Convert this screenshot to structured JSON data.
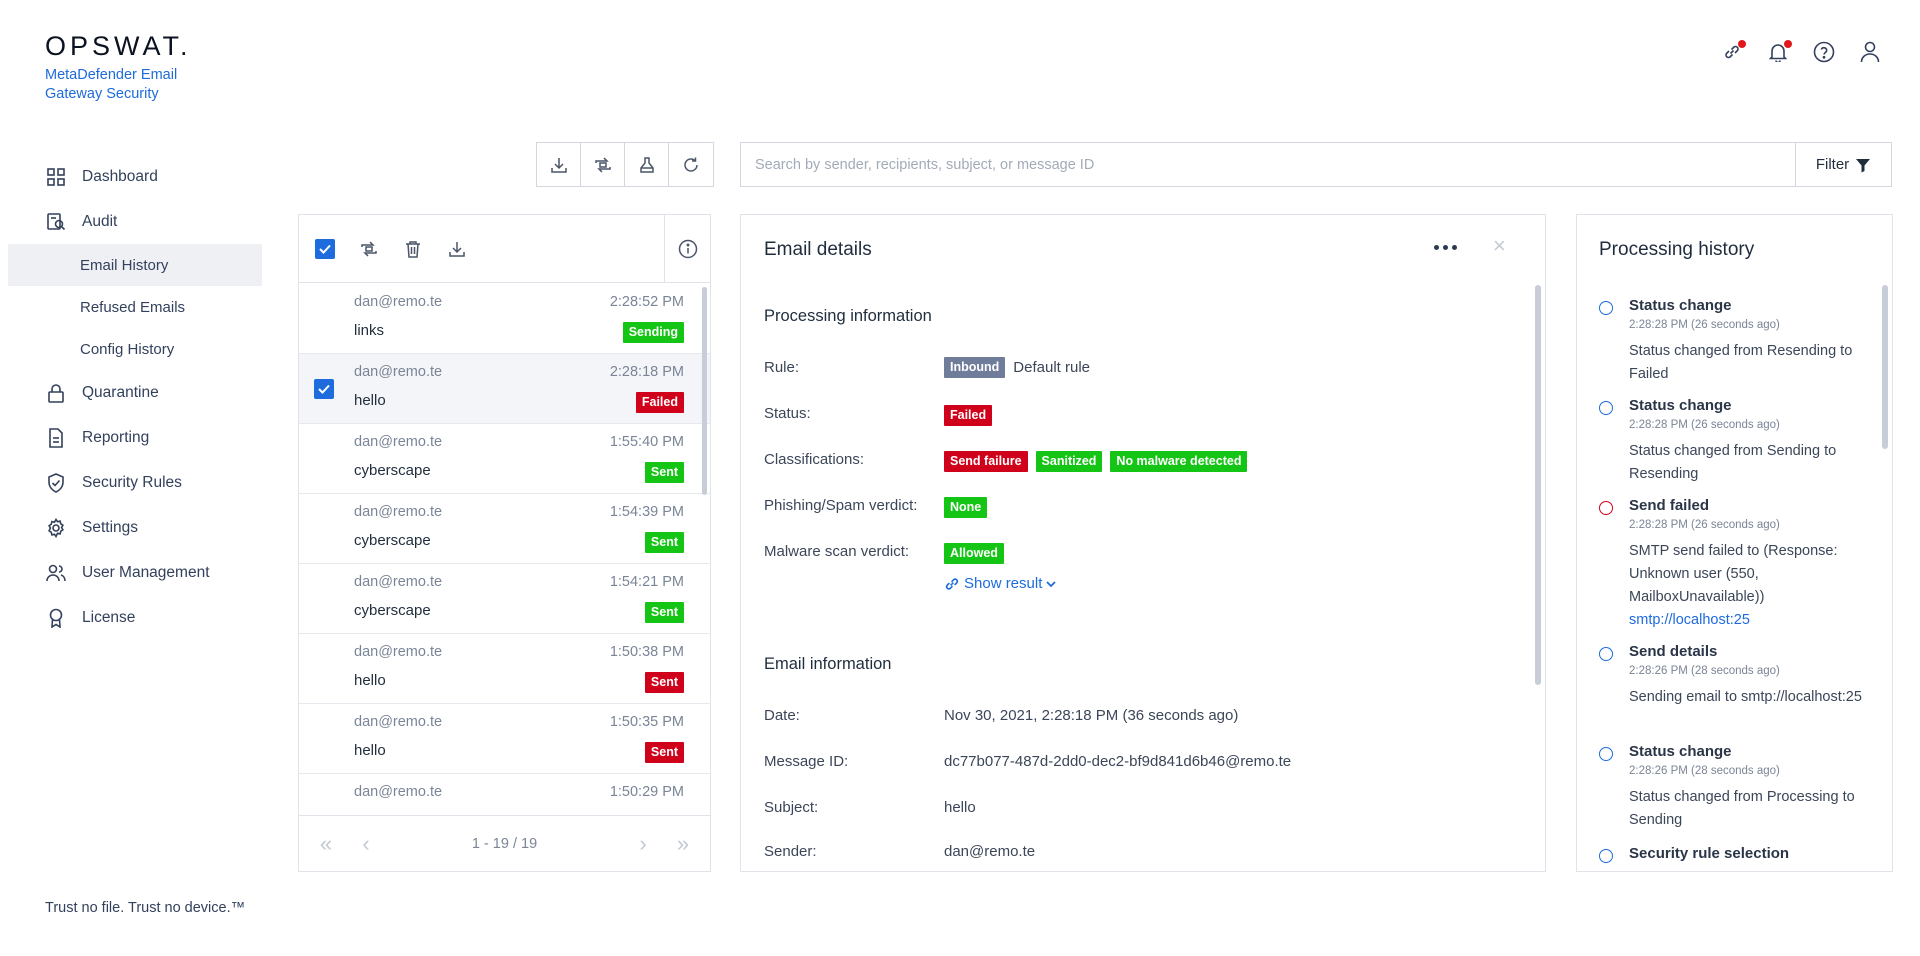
{
  "brand": {
    "logo": "OPSWAT.",
    "product": "MetaDefender Email Gateway Security"
  },
  "nav": {
    "dashboard": "Dashboard",
    "audit": "Audit",
    "email_history": "Email History",
    "refused_emails": "Refused Emails",
    "config_history": "Config History",
    "quarantine": "Quarantine",
    "reporting": "Reporting",
    "security_rules": "Security Rules",
    "settings": "Settings",
    "user_management": "User Management",
    "license": "License"
  },
  "footer": "Trust no file. Trust no device.™",
  "search": {
    "placeholder": "Search by sender, recipients, subject, or message ID",
    "filter_label": "Filter"
  },
  "list": {
    "rows": [
      {
        "from": "dan@remo.te",
        "time": "2:28:52 PM",
        "subject": "links",
        "status": "Sending",
        "status_color": "green",
        "selected": false
      },
      {
        "from": "dan@remo.te",
        "time": "2:28:18 PM",
        "subject": "hello",
        "status": "Failed",
        "status_color": "red",
        "selected": true
      },
      {
        "from": "dan@remo.te",
        "time": "1:55:40 PM",
        "subject": "cyberscape",
        "status": "Sent",
        "status_color": "green",
        "selected": false
      },
      {
        "from": "dan@remo.te",
        "time": "1:54:39 PM",
        "subject": "cyberscape",
        "status": "Sent",
        "status_color": "green",
        "selected": false
      },
      {
        "from": "dan@remo.te",
        "time": "1:54:21 PM",
        "subject": "cyberscape",
        "status": "Sent",
        "status_color": "green",
        "selected": false
      },
      {
        "from": "dan@remo.te",
        "time": "1:50:38 PM",
        "subject": "hello",
        "status": "Sent",
        "status_color": "red",
        "selected": false
      },
      {
        "from": "dan@remo.te",
        "time": "1:50:35 PM",
        "subject": "hello",
        "status": "Sent",
        "status_color": "red",
        "selected": false
      },
      {
        "from": "dan@remo.te",
        "time": "1:50:29 PM",
        "subject": "",
        "status": "",
        "status_color": "red",
        "selected": false
      }
    ],
    "pagination": "1 - 19 / 19"
  },
  "details": {
    "title": "Email details",
    "processing": {
      "title": "Processing information",
      "rule_label": "Rule:",
      "rule_badge": "Inbound",
      "rule_value": "Default rule",
      "status_label": "Status:",
      "status_badge": "Failed",
      "classifications_label": "Classifications:",
      "classifications": [
        "Send failure",
        "Sanitized",
        "No malware detected"
      ],
      "phishing_label": "Phishing/Spam verdict:",
      "phishing_badge": "None",
      "malware_label": "Malware scan verdict:",
      "malware_badge": "Allowed",
      "show_result": "Show result"
    },
    "email": {
      "title": "Email information",
      "date_label": "Date:",
      "date_value": "Nov 30, 2021, 2:28:18 PM (36 seconds ago)",
      "message_id_label": "Message ID:",
      "message_id_value": "dc77b077-487d-2dd0-dec2-bf9d841d6b46@remo.te",
      "subject_label": "Subject:",
      "subject_value": "hello",
      "sender_label": "Sender:",
      "sender_value": "dan@remo.te"
    }
  },
  "history": {
    "title": "Processing history",
    "events": [
      {
        "title": "Status change",
        "time": "2:28:28 PM (26 seconds ago)",
        "desc": "Status changed from Resending to Failed",
        "link": "",
        "color": "blue"
      },
      {
        "title": "Status change",
        "time": "2:28:28 PM (26 seconds ago)",
        "desc": "Status changed from Sending to Resending",
        "link": "",
        "color": "blue"
      },
      {
        "title": "Send failed",
        "time": "2:28:28 PM (26 seconds ago)",
        "desc": "SMTP send failed to (Response: Unknown user (550, MailboxUnavailable))",
        "link": "smtp://localhost:25",
        "color": "red"
      },
      {
        "title": "Send details",
        "time": "2:28:26 PM (28 seconds ago)",
        "desc": "Sending email to smtp://localhost:25",
        "link": "",
        "color": "blue"
      },
      {
        "title": "Status change",
        "time": "2:28:26 PM (28 seconds ago)",
        "desc": "Status changed from Processing to Sending",
        "link": "",
        "color": "blue"
      },
      {
        "title": "Security rule selection",
        "time": "",
        "desc": "",
        "link": "",
        "color": "blue"
      }
    ]
  },
  "colors": {
    "accent": "#1d6bdc",
    "green_badge": "#15c515",
    "red_badge": "#d0021b",
    "grey_badge": "#6f7c9a"
  },
  "icons": [
    "link-icon",
    "bell-icon",
    "help-icon",
    "user-icon",
    "download-icon",
    "resend-icon",
    "sanitize-icon",
    "refresh-icon",
    "filter-icon",
    "trash-icon",
    "info-icon"
  ]
}
